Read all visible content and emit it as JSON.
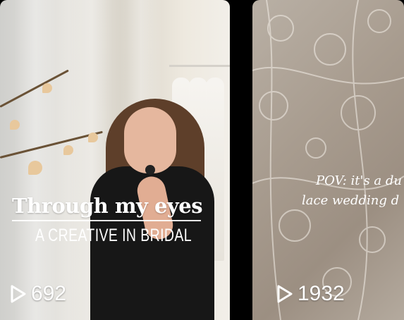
{
  "cards": [
    {
      "title_main": "Through my eyes",
      "title_sub": "A CREATIVE IN BRIDAL",
      "views": "692",
      "play_icon": "play-icon"
    },
    {
      "overlay_line1": "POV: it's a du",
      "overlay_line2": "lace wedding d",
      "views": "1932",
      "play_icon": "play-icon"
    }
  ],
  "colors": {
    "text": "#ffffff",
    "background": "#000000"
  }
}
